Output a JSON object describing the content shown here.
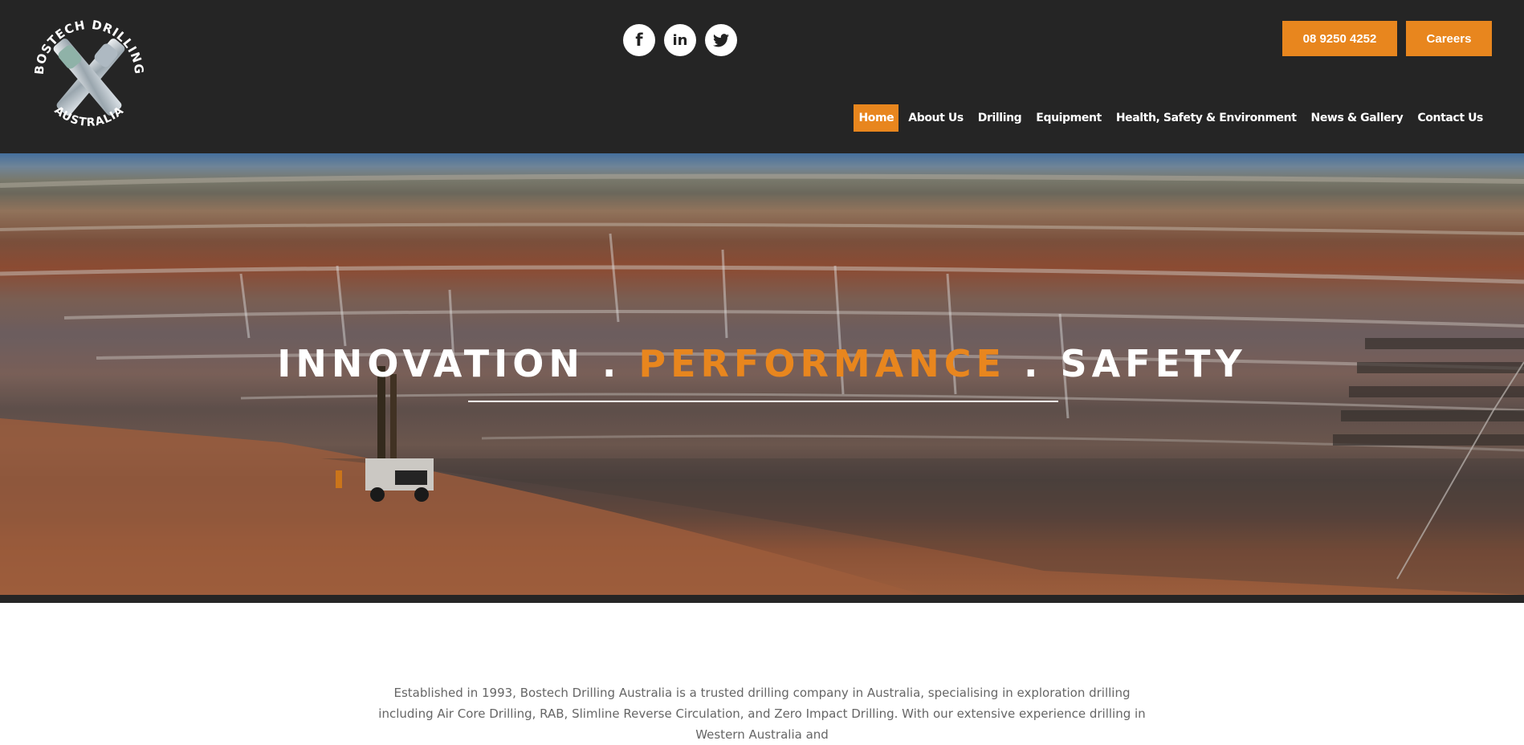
{
  "logo": {
    "top_text": "BOSTECH DRILLING",
    "bottom_text": "AUSTRALIA"
  },
  "social": [
    {
      "icon": "facebook-icon",
      "glyph": "f"
    },
    {
      "icon": "linkedin-icon",
      "glyph": "in"
    },
    {
      "icon": "twitter-icon",
      "glyph": ""
    }
  ],
  "header": {
    "phone_label": "08 9250 4252",
    "careers_label": "Careers"
  },
  "nav": {
    "items": [
      "Home",
      "About Us",
      "Drilling",
      "Equipment",
      "Health, Safety & Environment",
      "News & Gallery",
      "Contact Us"
    ],
    "active": "Home"
  },
  "hero": {
    "word1": "INNOVATION .",
    "word2": "PERFORMANCE",
    "word3": ". SAFETY"
  },
  "intro": {
    "text": "Established in 1993, Bostech Drilling Australia is a trusted drilling company in Australia, specialising in exploration drilling including Air Core Drilling, RAB, Slimline Reverse Circulation, and Zero Impact Drilling. With our extensive experience drilling in Western Australia and"
  },
  "colors": {
    "accent": "#e8861e",
    "header_bg": "#252525",
    "body_text": "#666666"
  }
}
